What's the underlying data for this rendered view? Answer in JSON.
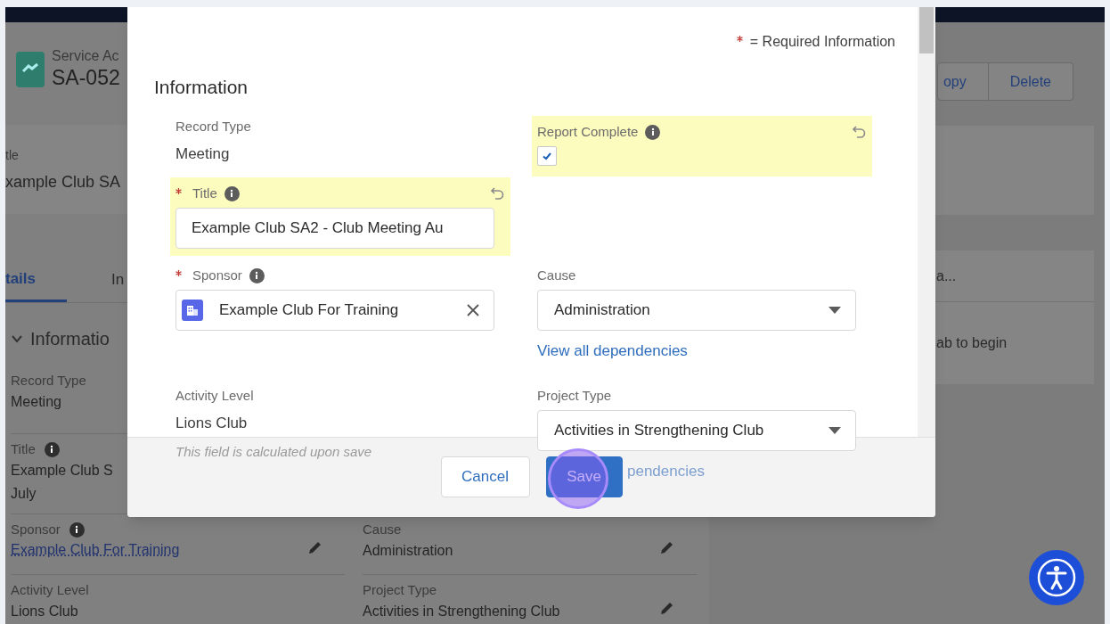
{
  "record_header": {
    "object_label": "Service Ac",
    "record_name": "SA-052",
    "actions": [
      "opy",
      "Delete"
    ]
  },
  "highlights_card": {
    "field_label": "tle",
    "field_value": "xample Club SA"
  },
  "tabs": [
    {
      "label": "tails",
      "selected": true
    },
    {
      "label": "In",
      "selected": false
    }
  ],
  "details_section": {
    "title": "Informatio",
    "expanded": true,
    "rows": [
      {
        "cells": [
          {
            "kind": "text",
            "label": "Record Type",
            "value": "Meeting"
          }
        ]
      },
      {
        "cells": [
          {
            "kind": "text",
            "label": "Title",
            "info": true,
            "value": "Example Club S\nJuly"
          }
        ]
      },
      {
        "cells": [
          {
            "kind": "link",
            "label": "Sponsor",
            "info": true,
            "value": "Example Club For Training",
            "editable": true
          },
          {
            "kind": "text",
            "label": "Cause",
            "value": "Administration",
            "editable": true
          }
        ]
      },
      {
        "cells": [
          {
            "kind": "text",
            "label": "Activity Level",
            "value": "Lions Club"
          },
          {
            "kind": "text",
            "label": "Project Type",
            "value": "Activities in Strengthening Club",
            "editable": true
          }
        ]
      }
    ]
  },
  "side_panel": {
    "tab_label": "a...",
    "message": "ab to begin"
  },
  "modal": {
    "required_legend": "= Required Information",
    "section_title": "Information",
    "rows": [
      {
        "left": {
          "kind": "readonly",
          "label": "Record Type",
          "value": "Meeting"
        },
        "right": {
          "kind": "checkbox",
          "label": "Report Complete",
          "info": true,
          "changed": true,
          "checked": true
        }
      },
      {
        "left": {
          "kind": "text",
          "label": "Title",
          "required": true,
          "info": true,
          "changed": true,
          "value": "Example Club SA2 - Club Meeting Au"
        }
      },
      {
        "left": {
          "kind": "lookup",
          "label": "Sponsor",
          "required": true,
          "info": true,
          "value": "Example Club For Training"
        },
        "right": {
          "kind": "picklist",
          "label": "Cause",
          "value": "Administration",
          "link": "View all dependencies"
        }
      },
      {
        "left": {
          "kind": "readonly",
          "label": "Activity Level",
          "value": "Lions Club",
          "note": "This field is calculated upon save"
        },
        "right": {
          "kind": "picklist",
          "label": "Project Type",
          "value": "Activities in Strengthening Club",
          "link": "pendencies"
        }
      }
    ],
    "buttons": [
      {
        "label": "Cancel",
        "kind": "neutral",
        "clicked": false
      },
      {
        "label": "Save",
        "kind": "brand",
        "clicked": true
      }
    ]
  }
}
